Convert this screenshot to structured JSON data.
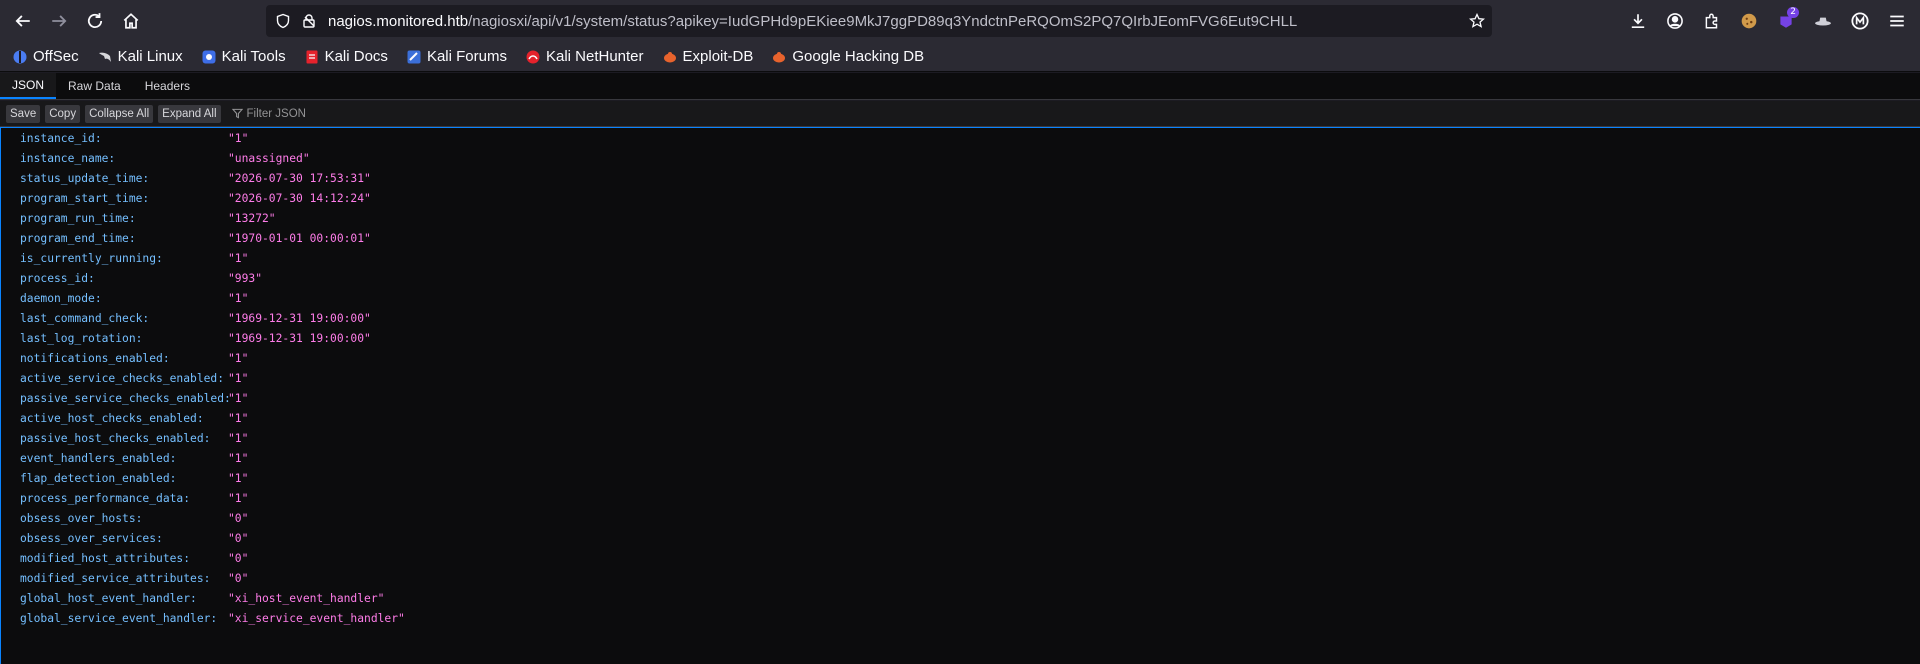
{
  "browser": {
    "url": {
      "host": "nagios.monitored.htb",
      "path": "/nagiosxi/api/v1/system/status?apikey=IudGPHd9pEKiee9MkJ7ggPD89q3YndctnPeRQOmS2PQ7QIrbJEomFVG6Eut9CHLL"
    },
    "extension_badge": "2",
    "icons": {
      "back": "arrow-left-icon",
      "forward": "arrow-right-icon",
      "reload": "reload-icon",
      "home": "home-icon",
      "shield": "shield-icon",
      "lock": "lock-icon",
      "star": "star-icon",
      "download": "download-icon",
      "account": "account-icon",
      "extensions": "puzzle-icon",
      "menu": "hamburger-menu-icon"
    }
  },
  "bookmarks": [
    {
      "label": "OffSec",
      "icon": "offsec-icon",
      "color": "#4a7cf2"
    },
    {
      "label": "Kali Linux",
      "icon": "kali-dragon-icon",
      "color": "#d7d7db"
    },
    {
      "label": "Kali Tools",
      "icon": "kali-tools-icon",
      "color": "#3e6ee8"
    },
    {
      "label": "Kali Docs",
      "icon": "kali-docs-icon",
      "color": "#e5222c"
    },
    {
      "label": "Kali Forums",
      "icon": "kali-forums-icon",
      "color": "#3b6fd9"
    },
    {
      "label": "Kali NetHunter",
      "icon": "nethunter-icon",
      "color": "#e5222c"
    },
    {
      "label": "Exploit-DB",
      "icon": "exploit-db-icon",
      "color": "#e8632d"
    },
    {
      "label": "Google Hacking DB",
      "icon": "ghdb-icon",
      "color": "#e8632d"
    }
  ],
  "viewer": {
    "tabs": [
      "JSON",
      "Raw Data",
      "Headers"
    ],
    "active_tab": "JSON",
    "toolbar": {
      "save": "Save",
      "copy": "Copy",
      "collapse_all": "Collapse All",
      "expand_all": "Expand All",
      "filter_placeholder": "Filter JSON"
    }
  },
  "json": [
    {
      "key": "instance_id:",
      "value": "\"1\""
    },
    {
      "key": "instance_name:",
      "value": "\"unassigned\""
    },
    {
      "key": "status_update_time:",
      "value": "\"2026-07-30 17:53:31\""
    },
    {
      "key": "program_start_time:",
      "value": "\"2026-07-30 14:12:24\""
    },
    {
      "key": "program_run_time:",
      "value": "\"13272\""
    },
    {
      "key": "program_end_time:",
      "value": "\"1970-01-01 00:00:01\""
    },
    {
      "key": "is_currently_running:",
      "value": "\"1\""
    },
    {
      "key": "process_id:",
      "value": "\"993\""
    },
    {
      "key": "daemon_mode:",
      "value": "\"1\""
    },
    {
      "key": "last_command_check:",
      "value": "\"1969-12-31 19:00:00\""
    },
    {
      "key": "last_log_rotation:",
      "value": "\"1969-12-31 19:00:00\""
    },
    {
      "key": "notifications_enabled:",
      "value": "\"1\""
    },
    {
      "key": "active_service_checks_enabled:",
      "value": "\"1\""
    },
    {
      "key": "passive_service_checks_enabled:",
      "value": "\"1\""
    },
    {
      "key": "active_host_checks_enabled:",
      "value": "\"1\""
    },
    {
      "key": "passive_host_checks_enabled:",
      "value": "\"1\""
    },
    {
      "key": "event_handlers_enabled:",
      "value": "\"1\""
    },
    {
      "key": "flap_detection_enabled:",
      "value": "\"1\""
    },
    {
      "key": "process_performance_data:",
      "value": "\"1\""
    },
    {
      "key": "obsess_over_hosts:",
      "value": "\"0\""
    },
    {
      "key": "obsess_over_services:",
      "value": "\"0\""
    },
    {
      "key": "modified_host_attributes:",
      "value": "\"0\""
    },
    {
      "key": "modified_service_attributes:",
      "value": "\"0\""
    },
    {
      "key": "global_host_event_handler:",
      "value": "\"xi_host_event_handler\""
    },
    {
      "key": "global_service_event_handler:",
      "value": "\"xi_service_event_handler\""
    }
  ]
}
